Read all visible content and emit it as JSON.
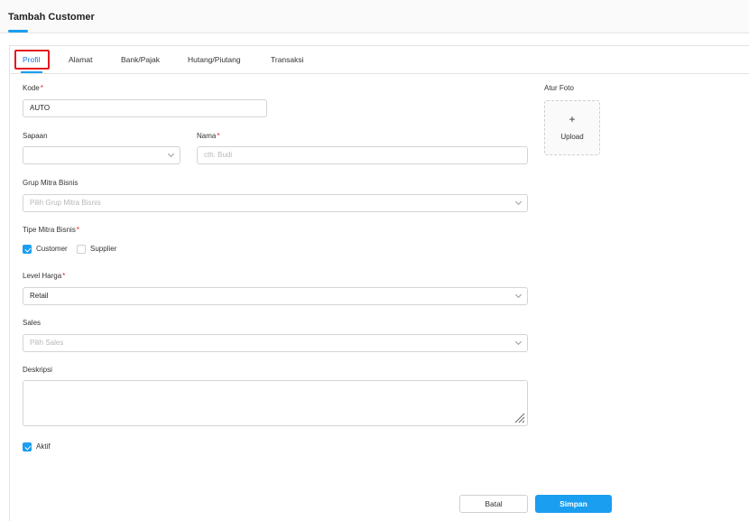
{
  "header": {
    "title": "Tambah Customer"
  },
  "tabs": [
    {
      "label": "Profil",
      "active": true
    },
    {
      "label": "Alamat"
    },
    {
      "label": "Bank/Pajak"
    },
    {
      "label": "Hutang/Piutang"
    },
    {
      "label": "Transaksi"
    }
  ],
  "form": {
    "kode": {
      "label": "Kode",
      "value": "AUTO"
    },
    "sapaan": {
      "label": "Sapaan",
      "value": ""
    },
    "nama": {
      "label": "Nama",
      "placeholder": "cth. Budi"
    },
    "grup": {
      "label": "Grup Mitra Bisnis",
      "placeholder": "Pilih Grup Mitra Bisnis"
    },
    "tipe": {
      "label": "Tipe Mitra Bisnis",
      "options": [
        {
          "label": "Customer",
          "checked": true
        },
        {
          "label": "Supplier",
          "checked": false
        }
      ]
    },
    "level_harga": {
      "label": "Level Harga",
      "value": "Retail"
    },
    "sales": {
      "label": "Sales",
      "placeholder": "Pilih Sales"
    },
    "deskripsi": {
      "label": "Deskripsi",
      "value": ""
    },
    "aktif": {
      "label": "Aktif",
      "checked": true
    },
    "required_mark": "*"
  },
  "foto": {
    "label": "Atur Foto",
    "plus": "+",
    "upload_label": "Upload"
  },
  "actions": {
    "cancel_label": "Batal",
    "save_label": "Simpan"
  },
  "colors": {
    "accent": "#1a9ef0",
    "required": "#e3191f",
    "highlight": "#e3191f"
  }
}
